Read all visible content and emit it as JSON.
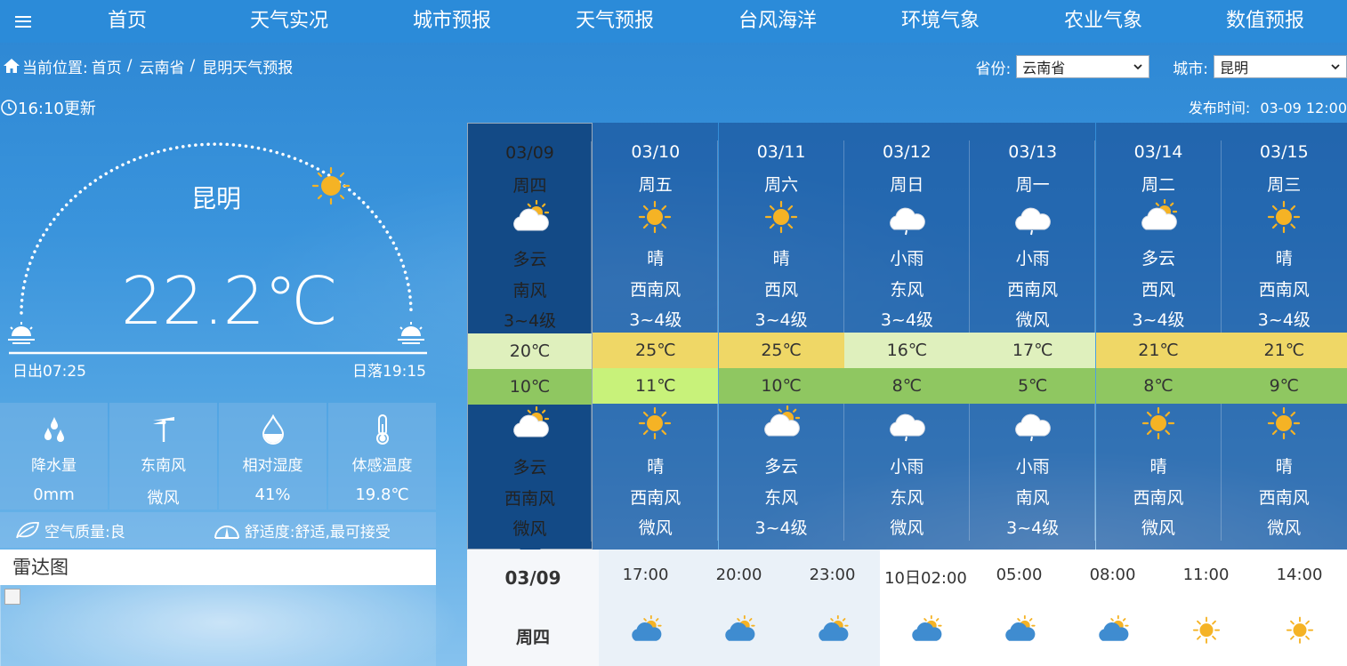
{
  "nav": {
    "items": [
      "首页",
      "天气实况",
      "城市预报",
      "天气预报",
      "台风海洋",
      "环境气象",
      "农业气象",
      "数值预报"
    ]
  },
  "breadcrumb": {
    "prefix": "当前位置:",
    "items": [
      "首页",
      "云南省",
      "昆明天气预报"
    ]
  },
  "selectors": {
    "province_label": "省份:",
    "province_value": "云南省",
    "city_label": "城市:",
    "city_value": "昆明"
  },
  "update_text": "16:10更新",
  "publish": {
    "label": "发布时间:",
    "value": "03-09 12:00"
  },
  "current": {
    "city": "昆明",
    "temperature": "22.2℃",
    "sunrise": "日出07:25",
    "sunset": "日落19:15",
    "stats": [
      {
        "label": "降水量",
        "value": "0mm",
        "icon": "raindrops-icon"
      },
      {
        "label": "东南风",
        "value": "微风",
        "icon": "wind-vane-icon"
      },
      {
        "label": "相对湿度",
        "value": "41%",
        "icon": "humidity-drop-icon"
      },
      {
        "label": "体感温度",
        "value": "19.8℃",
        "icon": "thermometer-icon"
      }
    ],
    "air_quality": "空气质量:良",
    "comfort": "舒适度:舒适,最可接受"
  },
  "radar": {
    "title": "雷达图"
  },
  "forecast": [
    {
      "date": "03/09",
      "week": "周四",
      "day_icon": "partly-cloudy",
      "day_weather": "多云",
      "day_wind_dir": "南风",
      "day_wind_level": "3~4级",
      "high": "20℃",
      "low": "10℃",
      "night_icon": "partly-cloudy",
      "night_weather": "多云",
      "night_wind_dir": "西南风",
      "night_wind_level": "微风",
      "high_color": "#dff0bd",
      "low_color": "#8fc761"
    },
    {
      "date": "03/10",
      "week": "周五",
      "day_icon": "sunny",
      "day_weather": "晴",
      "day_wind_dir": "西南风",
      "day_wind_level": "3~4级",
      "high": "25℃",
      "low": "11℃",
      "night_icon": "sunny",
      "night_weather": "晴",
      "night_wind_dir": "西南风",
      "night_wind_level": "微风",
      "high_color": "#efd766",
      "low_color": "#c8f27a"
    },
    {
      "date": "03/11",
      "week": "周六",
      "day_icon": "sunny",
      "day_weather": "晴",
      "day_wind_dir": "西风",
      "day_wind_level": "3~4级",
      "high": "25℃",
      "low": "10℃",
      "night_icon": "partly-cloudy",
      "night_weather": "多云",
      "night_wind_dir": "东风",
      "night_wind_level": "3~4级",
      "high_color": "#efd766",
      "low_color": "#8fc761"
    },
    {
      "date": "03/12",
      "week": "周日",
      "day_icon": "light-rain",
      "day_weather": "小雨",
      "day_wind_dir": "东风",
      "day_wind_level": "3~4级",
      "high": "16℃",
      "low": "8℃",
      "night_icon": "light-rain",
      "night_weather": "小雨",
      "night_wind_dir": "东风",
      "night_wind_level": "微风",
      "high_color": "#dff0bd",
      "low_color": "#8fc761"
    },
    {
      "date": "03/13",
      "week": "周一",
      "day_icon": "light-rain",
      "day_weather": "小雨",
      "day_wind_dir": "西南风",
      "day_wind_level": "微风",
      "high": "17℃",
      "low": "5℃",
      "night_icon": "light-rain",
      "night_weather": "小雨",
      "night_wind_dir": "南风",
      "night_wind_level": "3~4级",
      "high_color": "#dff0bd",
      "low_color": "#8fc761"
    },
    {
      "date": "03/14",
      "week": "周二",
      "day_icon": "partly-cloudy",
      "day_weather": "多云",
      "day_wind_dir": "西风",
      "day_wind_level": "3~4级",
      "high": "21℃",
      "low": "8℃",
      "night_icon": "sunny",
      "night_weather": "晴",
      "night_wind_dir": "西南风",
      "night_wind_level": "微风",
      "high_color": "#efd766",
      "low_color": "#8fc761"
    },
    {
      "date": "03/15",
      "week": "周三",
      "day_icon": "sunny",
      "day_weather": "晴",
      "day_wind_dir": "西南风",
      "day_wind_level": "3~4级",
      "high": "21℃",
      "low": "9℃",
      "night_icon": "sunny",
      "night_weather": "晴",
      "night_wind_dir": "西南风",
      "night_wind_level": "微风",
      "high_color": "#efd766",
      "low_color": "#8fc761"
    }
  ],
  "hourly": {
    "date": "03/09",
    "week": "周四",
    "items": [
      {
        "time": "17:00",
        "icon": "partly-cloudy"
      },
      {
        "time": "20:00",
        "icon": "partly-cloudy"
      },
      {
        "time": "23:00",
        "icon": "partly-cloudy"
      },
      {
        "time": "10日02:00",
        "icon": "partly-cloudy"
      },
      {
        "time": "05:00",
        "icon": "partly-cloudy"
      },
      {
        "time": "08:00",
        "icon": "partly-cloudy"
      },
      {
        "time": "11:00",
        "icon": "sunny"
      },
      {
        "time": "14:00",
        "icon": "sunny"
      }
    ]
  }
}
